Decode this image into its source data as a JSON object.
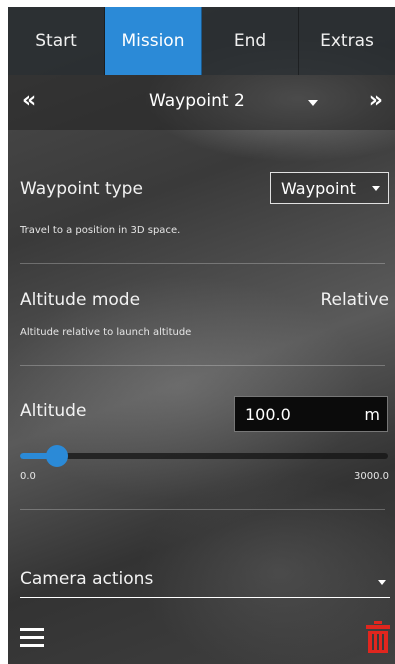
{
  "tabs": [
    "Start",
    "Mission",
    "End",
    "Extras"
  ],
  "active_tab": "Mission",
  "waypoint_nav": {
    "prev": "«",
    "name": "Waypoint 2",
    "next": "»"
  },
  "waypoint_type": {
    "label": "Waypoint type",
    "selected": "Waypoint",
    "description": "Travel to a position in 3D space."
  },
  "altitude_mode": {
    "label": "Altitude mode",
    "value": "Relative",
    "description": "Altitude relative to launch altitude"
  },
  "altitude": {
    "label": "Altitude",
    "value": "100.0",
    "unit": "m",
    "min_label": "0.0",
    "max_label": "3000.0",
    "slider_fraction": 0.1
  },
  "camera_actions": {
    "label": "Camera actions"
  },
  "icons": {
    "menu": "hamburger-menu-icon",
    "delete": "trash-icon"
  },
  "colors": {
    "accent": "#2b8ad7",
    "delete": "#e0261e"
  }
}
